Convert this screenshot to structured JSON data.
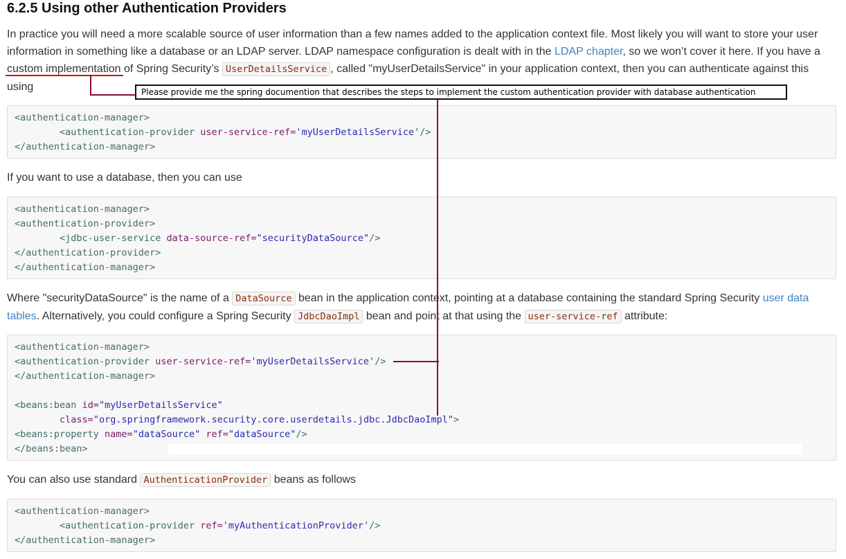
{
  "heading": "6.2.5 Using other Authentication Providers",
  "intro": {
    "t1": "In practice you will need a more scalable source of user information than a few names added to the application context file. Most likely you will want to store your user information in something like a database or an LDAP server. LDAP namespace configuration is dealt with in the ",
    "link_ldap": "LDAP chapter",
    "t2": ", so we won’t cover it here. If you have a ",
    "underlined": "custom implementation",
    "t3": " of Spring Security’s ",
    "code_uds": "UserDetailsService",
    "t4": ", called \"myUserDetailsService\" in your application context, then you can authenticate against this using"
  },
  "annotation": {
    "text": "Please provide me the spring documention that describes the steps to implement the custom authentication provider with database authentication",
    "line_color": "#8b0a2a",
    "underline_color": "#cc1111"
  },
  "code1": {
    "l1": "<authentication-manager>",
    "l2_indent": "        ",
    "l2_tag": "<authentication-provider ",
    "l2_attr": "user-service-ref=",
    "l2_val": "'myUserDetailsService'",
    "l2_end": "/>",
    "l3": "</authentication-manager>"
  },
  "para_db": "If you want to use a database, then you can use",
  "code2": {
    "l1": "<authentication-manager>",
    "l2": "<authentication-provider>",
    "l3_indent": "        ",
    "l3_tag": "<jdbc-user-service ",
    "l3_attr": "data-source-ref=",
    "l3_val": "\"securityDataSource\"",
    "l3_end": "/>",
    "l4": "</authentication-provider>",
    "l5": "</authentication-manager>"
  },
  "para_where": {
    "t1": "Where \"securityDataSource\" is the name of a ",
    "code_ds": "DataSource",
    "t2": " bean in the application context, pointing at a database containing the standard Spring Security ",
    "link_tables": "user data tables",
    "t3": ". Alternatively, you could configure a Spring Security ",
    "code_jdbc": "JdbcDaoImpl",
    "t4": " bean and point at that using the ",
    "code_usr": "user-service-ref",
    "t5": " attribute:"
  },
  "code3": {
    "l1": "<authentication-manager>",
    "l2_tag": "<authentication-provider ",
    "l2_attr": "user-service-ref=",
    "l2_val": "'myUserDetailsService'",
    "l2_end": "/>",
    "l3": "</authentication-manager>",
    "l5_tag": "<beans:bean ",
    "l5_attr": "id=",
    "l5_val": "\"myUserDetailsService\"",
    "l6_indent": "        ",
    "l6_attr": "class=",
    "l6_val": "\"org.springframework.security.core.userdetails.jdbc.JdbcDaoImpl\"",
    "l6_end": ">",
    "l7_tag": "<beans:property ",
    "l7_attr1": "name=",
    "l7_val1": "\"dataSource\"",
    "l7_attr2": " ref=",
    "l7_val2": "\"dataSource\"",
    "l7_end": "/>",
    "l8": "</beans:bean>"
  },
  "para_also": {
    "t1": "You can also use standard ",
    "code_ap": "AuthenticationProvider",
    "t2": " beans as follows"
  },
  "code4": {
    "l1": "<authentication-manager>",
    "l2_indent": "        ",
    "l2_tag": "<authentication-provider ",
    "l2_attr": "ref=",
    "l2_val": "'myAuthenticationProvider'",
    "l2_end": "/>",
    "l3": "</authentication-manager>"
  }
}
